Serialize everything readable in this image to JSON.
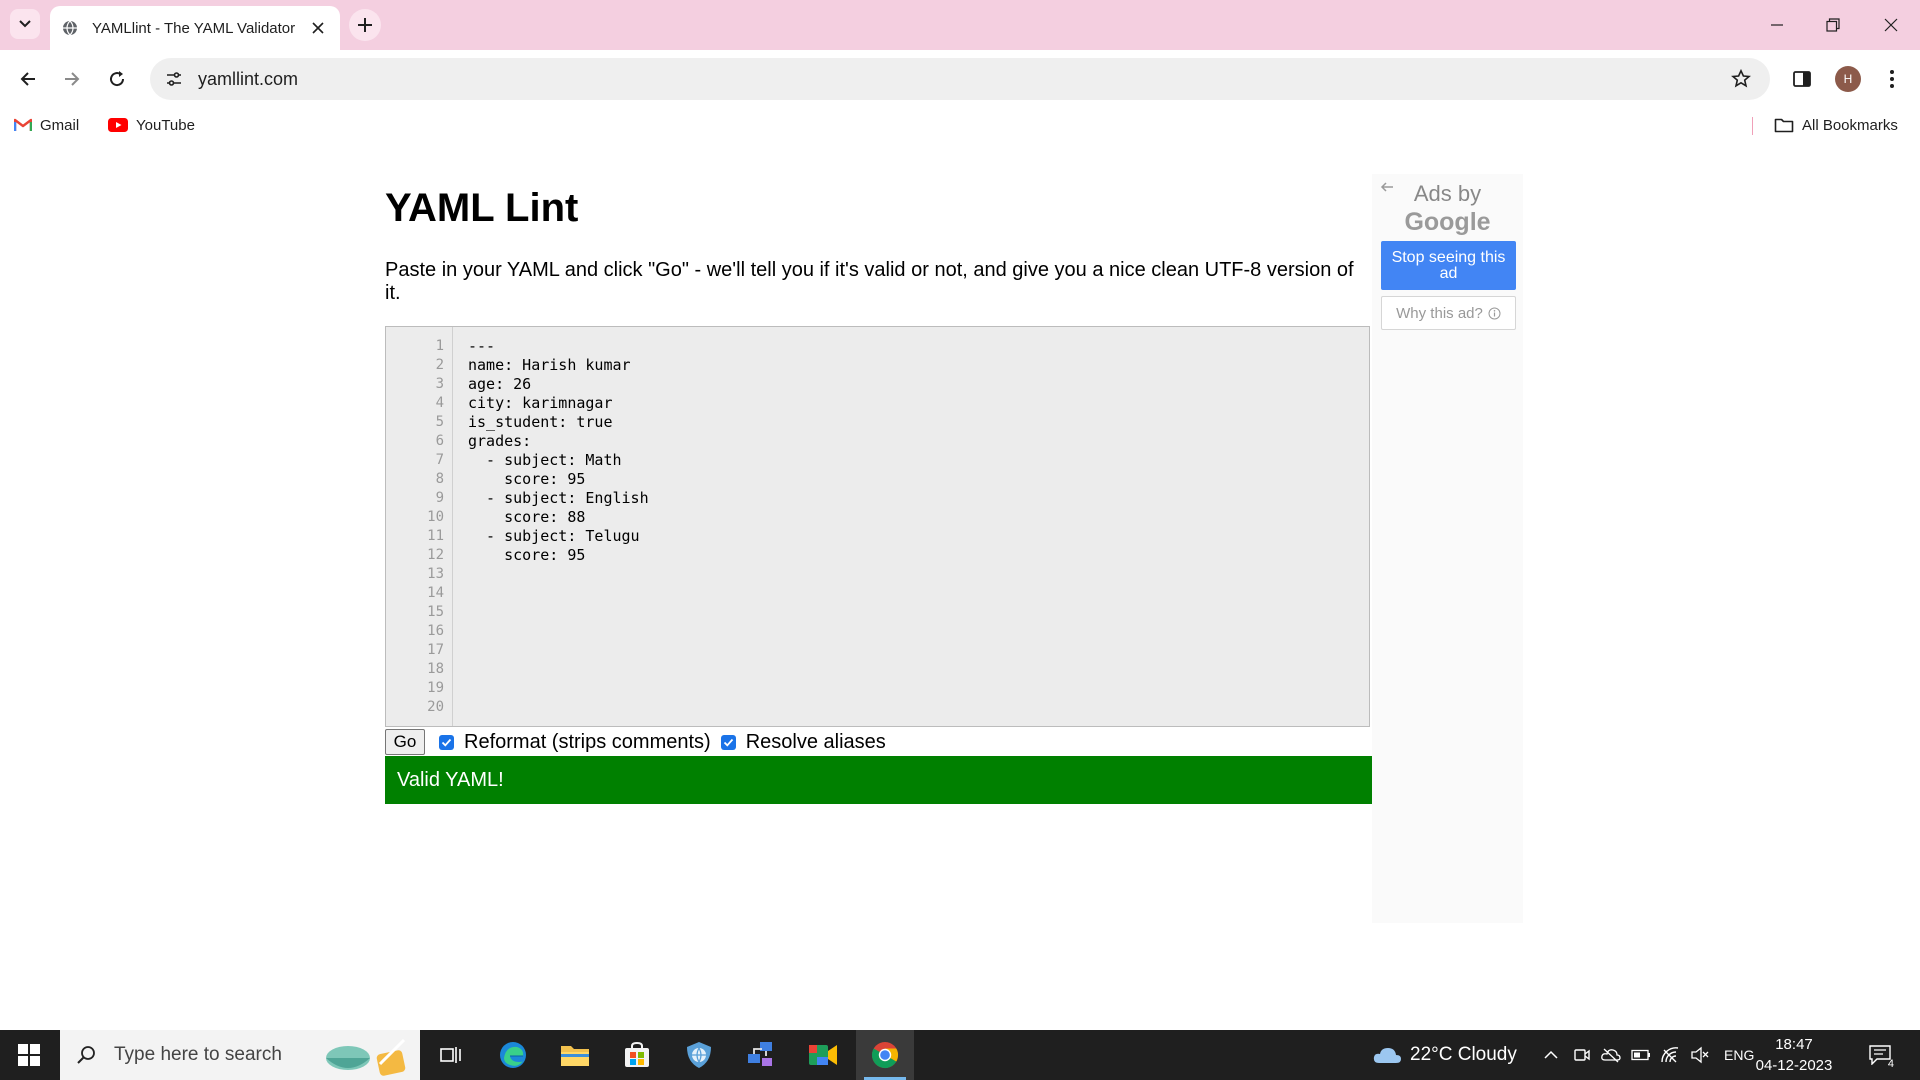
{
  "browser": {
    "tab_title": "YAMLlint - The YAML Validator",
    "url": "yamllint.com",
    "profile_initial": "H",
    "bookmarks": [
      {
        "label": "Gmail"
      },
      {
        "label": "YouTube"
      }
    ],
    "all_bookmarks_label": "All Bookmarks"
  },
  "page": {
    "title": "YAML Lint",
    "description": "Paste in your YAML and click \"Go\" - we'll tell you if it's valid or not, and give you a nice clean UTF-8 version of it.",
    "editor": {
      "line_numbers": [
        "1",
        "2",
        "3",
        "4",
        "5",
        "6",
        "7",
        "8",
        "9",
        "10",
        "11",
        "12",
        "13",
        "14",
        "15",
        "16",
        "17",
        "18",
        "19",
        "20"
      ],
      "lines": [
        "---",
        "name: Harish kumar",
        "age: 26",
        "city: karimnagar",
        "is_student: true",
        "grades:",
        "  - subject: Math",
        "    score: 95",
        "  - subject: English",
        "    score: 88",
        "  - subject: Telugu",
        "    score: 95"
      ]
    },
    "go_label": "Go",
    "reformat_label": "Reformat (strips comments)",
    "reformat_checked": true,
    "aliases_label": "Resolve aliases",
    "aliases_checked": true,
    "result_text": "Valid YAML!",
    "result_color": "#008000"
  },
  "ad": {
    "ads_by": "Ads by",
    "google": "Google",
    "stop_label": "Stop seeing this ad",
    "why_label": "Why this ad?"
  },
  "taskbar": {
    "search_placeholder": "Type here to search",
    "weather": "22°C  Cloudy",
    "language": "ENG",
    "time": "18:47",
    "date": "04-12-2023",
    "notification_count": "4"
  }
}
